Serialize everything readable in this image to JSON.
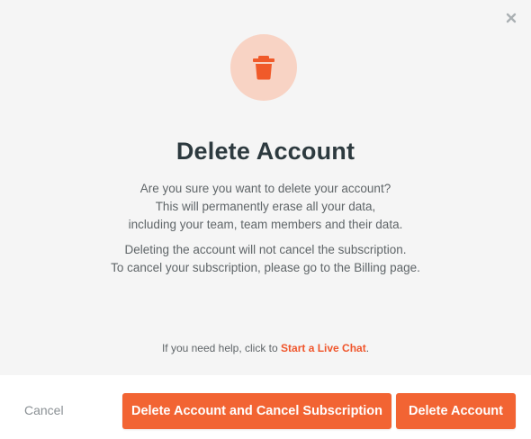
{
  "dialog": {
    "title": "Delete Account",
    "message_lines": [
      "Are you sure you want to delete your account?",
      "This will permanently erase all your data,",
      "including your team, team members and their data."
    ],
    "note_lines": [
      "Deleting the account will not cancel the subscription.",
      "To cancel your subscription, please go to the Billing page."
    ],
    "help_prefix": "If you need help, click to ",
    "help_link": "Start a Live Chat",
    "help_suffix": "."
  },
  "footer": {
    "cancel_label": "Cancel",
    "delete_and_cancel_label": "Delete Account and Cancel Subscription",
    "delete_label": "Delete Account"
  },
  "icons": {
    "close": "close-icon",
    "trash": "trash-icon"
  },
  "colors": {
    "accent": "#f26433",
    "accent_light": "#f8d3c4",
    "title": "#2d3a3f",
    "body_text": "#5f6568",
    "body_bg": "#f5f5f5"
  }
}
